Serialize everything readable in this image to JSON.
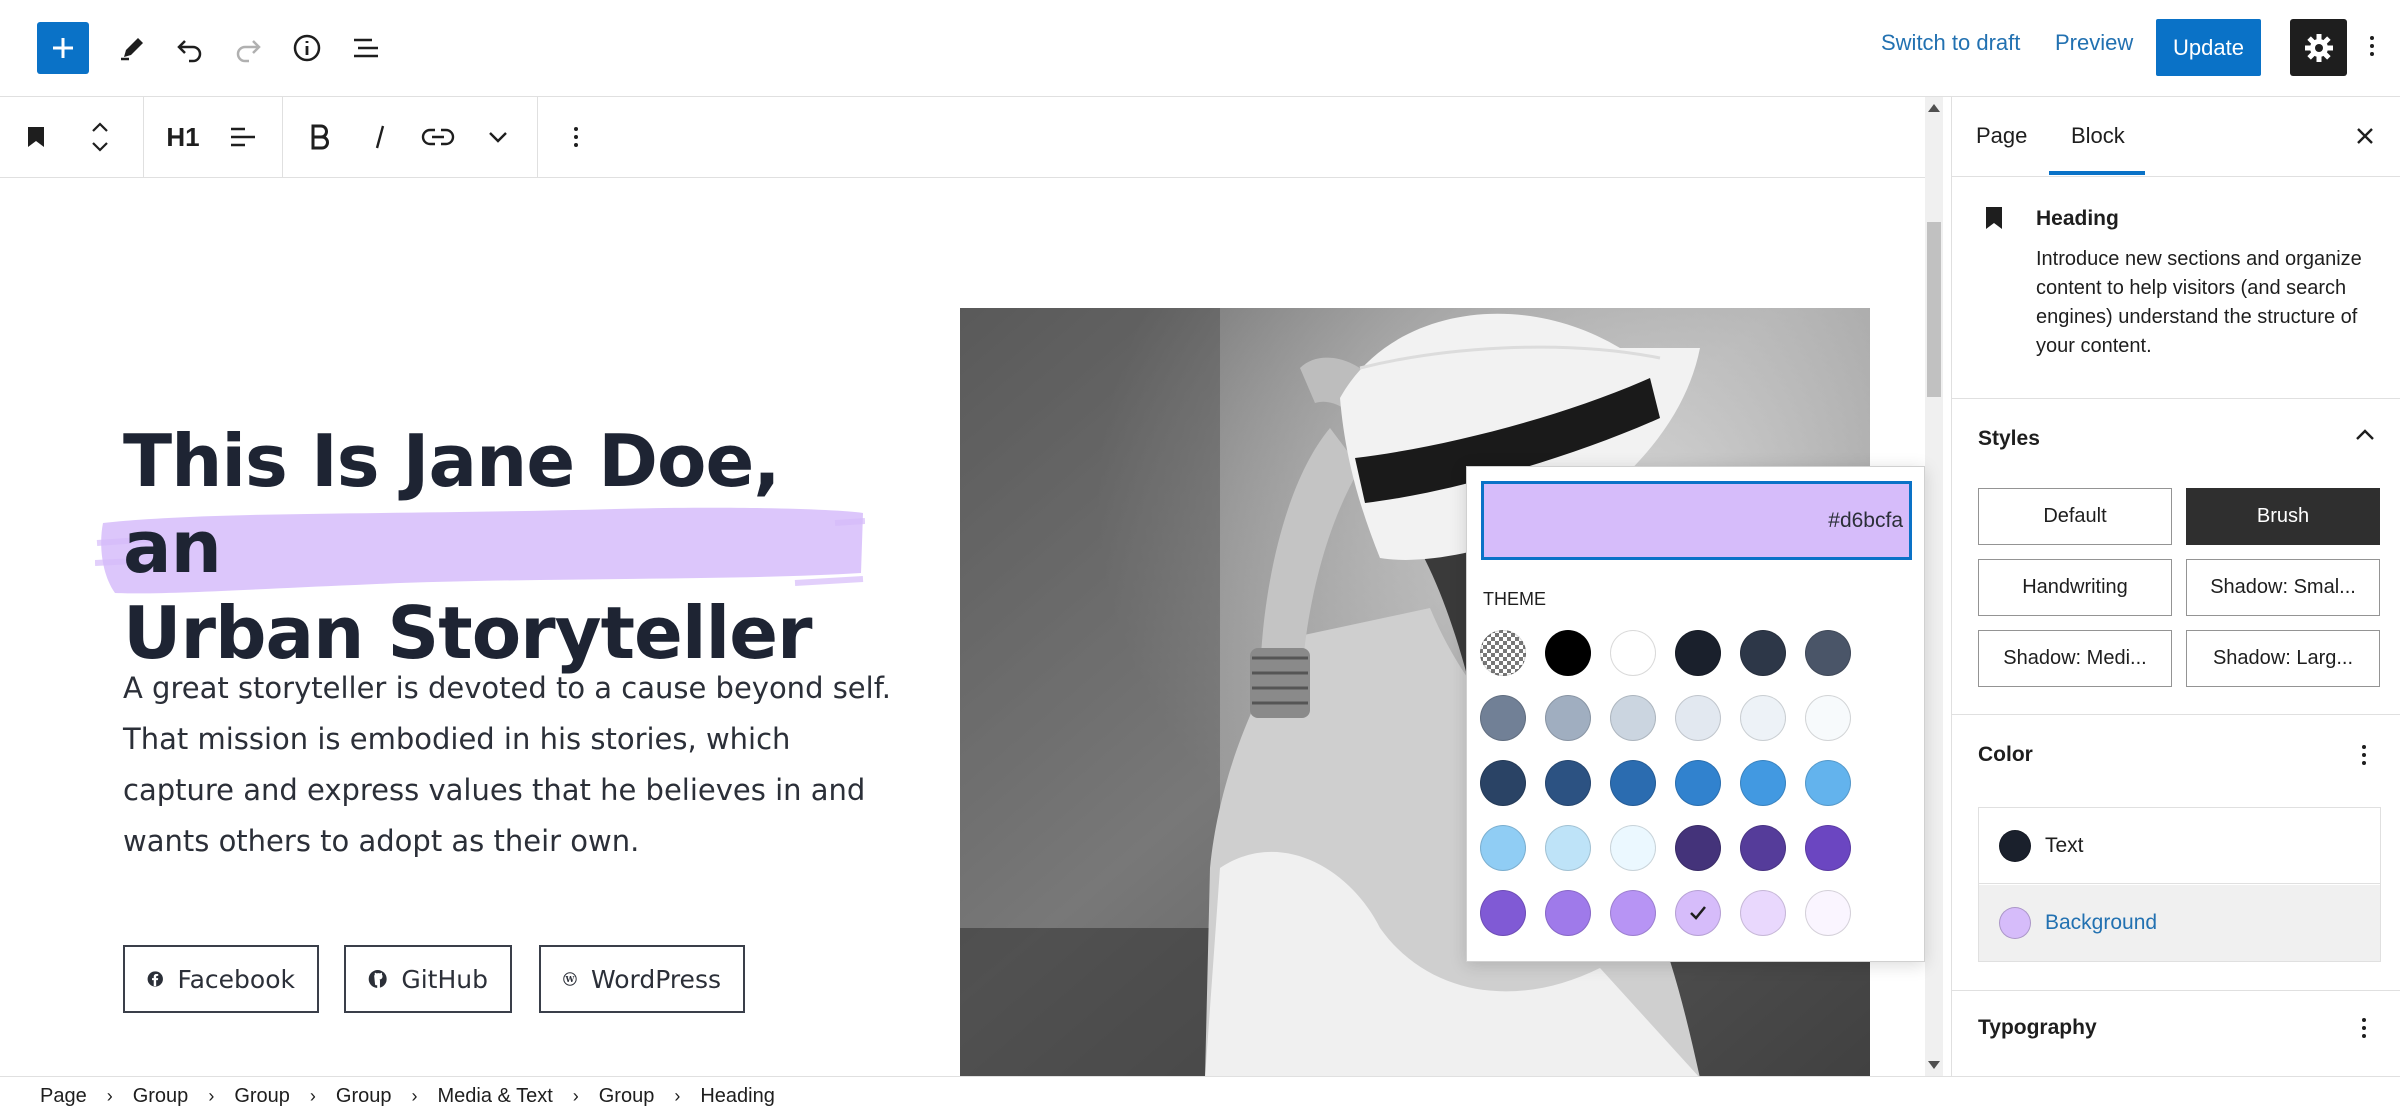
{
  "header": {
    "switch_to_draft": "Switch to draft",
    "preview": "Preview",
    "update": "Update"
  },
  "block_toolbar": {
    "heading_level": "H1"
  },
  "content": {
    "heading_line1": "This Is Jane Doe, an",
    "heading_line2": "Urban Storyteller",
    "paragraph": "A great storyteller is devoted to a cause beyond self. That mission is embodied in his stories, which capture and express values that he believes in and wants others to adopt as their own.",
    "social": [
      {
        "label": "Facebook",
        "icon": "facebook-icon"
      },
      {
        "label": "GitHub",
        "icon": "github-icon"
      },
      {
        "label": "WordPress",
        "icon": "wordpress-icon"
      }
    ]
  },
  "color_picker": {
    "hex_value": "#d6bcfa",
    "theme_label": "THEME",
    "swatches": [
      [
        "transparent",
        "#000000",
        "#ffffff",
        "#1a202c",
        "#2d3748",
        "#4a5568"
      ],
      [
        "#718096",
        "#a0aec0",
        "#cbd5e0",
        "#e2e8f0",
        "#edf2f7",
        "#f7fafc"
      ],
      [
        "#2a4365",
        "#2c5282",
        "#2b6cb0",
        "#3182ce",
        "#4299e1",
        "#63b3ed"
      ],
      [
        "#90cdf4",
        "#bee3f8",
        "#ebf8ff",
        "#44337a",
        "#553c9a",
        "#6b46c1"
      ],
      [
        "#805ad5",
        "#9f7aea",
        "#b794f4",
        "#d6bcfa",
        "#e9d8fd",
        "#faf5ff"
      ]
    ],
    "selected": "#d6bcfa"
  },
  "sidebar": {
    "tabs": [
      "Page",
      "Block"
    ],
    "active_tab": "Block",
    "block_name": "Heading",
    "block_description": "Introduce new sections and organize content to help visitors (and search engines) understand the structure of your content.",
    "styles_title": "Styles",
    "styles": [
      "Default",
      "Brush",
      "Handwriting",
      "Shadow: Smal...",
      "Shadow: Medi...",
      "Shadow: Larg..."
    ],
    "active_style": "Brush",
    "color_title": "Color",
    "color_text_label": "Text",
    "color_background_label": "Background",
    "text_color": "#1a202c",
    "background_color": "#d6bcfa",
    "typography_title": "Typography"
  },
  "breadcrumb": [
    "Page",
    "Group",
    "Group",
    "Group",
    "Media & Text",
    "Group",
    "Heading"
  ],
  "colors": {
    "accent": "#0a72c7",
    "link": "#2271b1",
    "brush": "#d6bcfa"
  }
}
